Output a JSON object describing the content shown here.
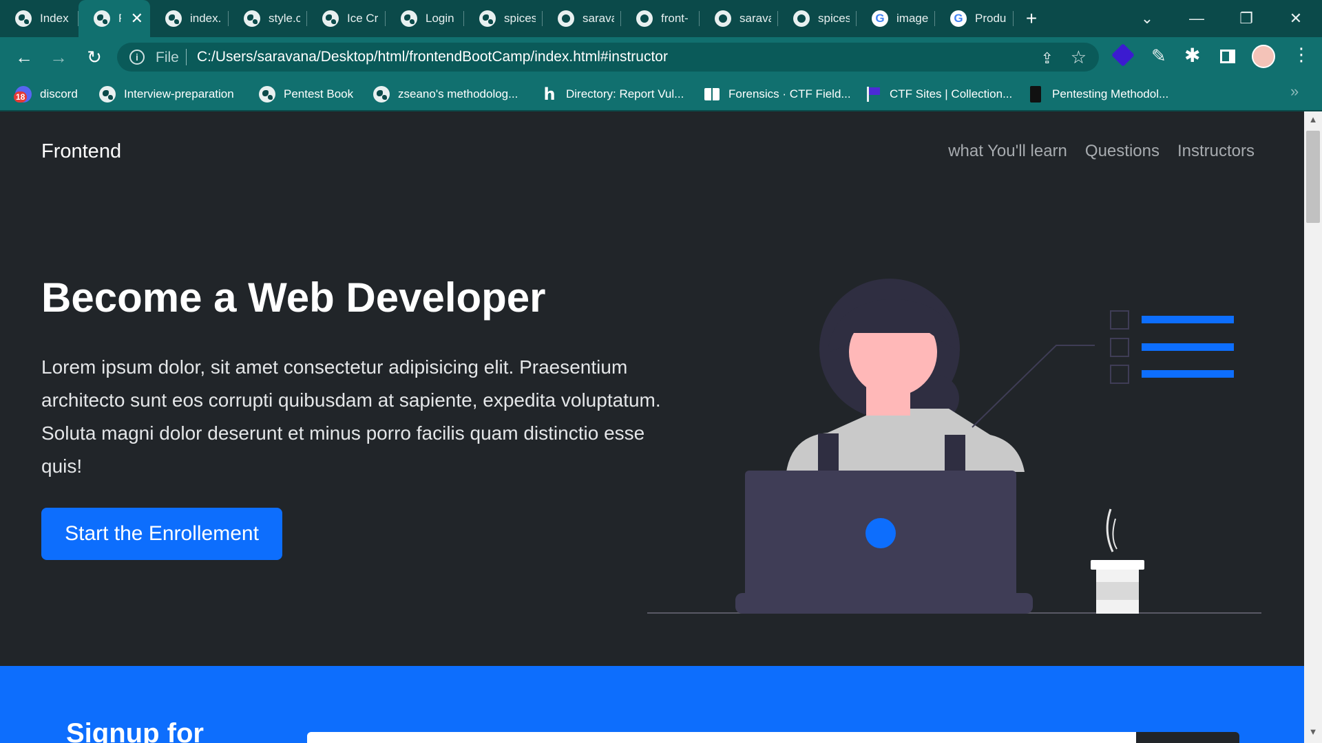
{
  "browser": {
    "tabs": [
      {
        "title": "Index",
        "icon": "globe-icon",
        "active": false
      },
      {
        "title": "Fr",
        "icon": "globe-icon",
        "active": true
      },
      {
        "title": "index.",
        "icon": "globe-icon",
        "active": false
      },
      {
        "title": "style.c",
        "icon": "globe-icon",
        "active": false
      },
      {
        "title": "Ice Cre",
        "icon": "globe-icon",
        "active": false
      },
      {
        "title": "Login",
        "icon": "globe-icon",
        "active": false
      },
      {
        "title": "spices",
        "icon": "globe-icon",
        "active": false
      },
      {
        "title": "sarava",
        "icon": "github-icon",
        "active": false
      },
      {
        "title": "front-",
        "icon": "github-icon",
        "active": false
      },
      {
        "title": "sarava",
        "icon": "github-icon",
        "active": false
      },
      {
        "title": "spices",
        "icon": "github-icon",
        "active": false
      },
      {
        "title": "image",
        "icon": "google-icon",
        "active": false
      },
      {
        "title": "Produ",
        "icon": "google-icon",
        "active": false
      }
    ],
    "new_tab_label": "+",
    "address": {
      "scheme_label": "File",
      "url": "C:/Users/saravana/Desktop/html/frontendBootCamp/index.html#instructor"
    },
    "bookmarks": [
      {
        "label": "discord",
        "badge": "18",
        "icon": "discord-icon"
      },
      {
        "label": "Interview-preparation",
        "icon": "globe-icon"
      },
      {
        "label": "Pentest Book",
        "icon": "globe-icon"
      },
      {
        "label": "zseano's methodolog...",
        "icon": "globe-icon"
      },
      {
        "label": "Directory: Report Vul...",
        "icon": "hackerone-icon"
      },
      {
        "label": "Forensics · CTF Field...",
        "icon": "book-icon"
      },
      {
        "label": "CTF Sites | Collection...",
        "icon": "flag-icon"
      },
      {
        "label": "Pentesting Methodol...",
        "icon": "dark-icon"
      }
    ],
    "bookmarks_more": "»"
  },
  "navbar": {
    "brand": "Frontend",
    "links": [
      "what You'll learn",
      "Questions",
      "Instructors"
    ]
  },
  "hero": {
    "title": "Become a Web Developer",
    "text": "Lorem ipsum dolor, sit amet consectetur adipisicing elit. Praesentium architecto sunt eos corrupti quibusdam at sapiente, expedita voluptatum. Soluta magni dolor deserunt et minus porro facilis quam distinctio esse quis!",
    "cta_label": "Start the Enrollement"
  },
  "signup": {
    "title": "Signup for"
  },
  "colors": {
    "page_bg": "#212529",
    "accent": "#0d6efd",
    "chrome_dark": "#0b4a4a",
    "chrome": "#11706f"
  }
}
